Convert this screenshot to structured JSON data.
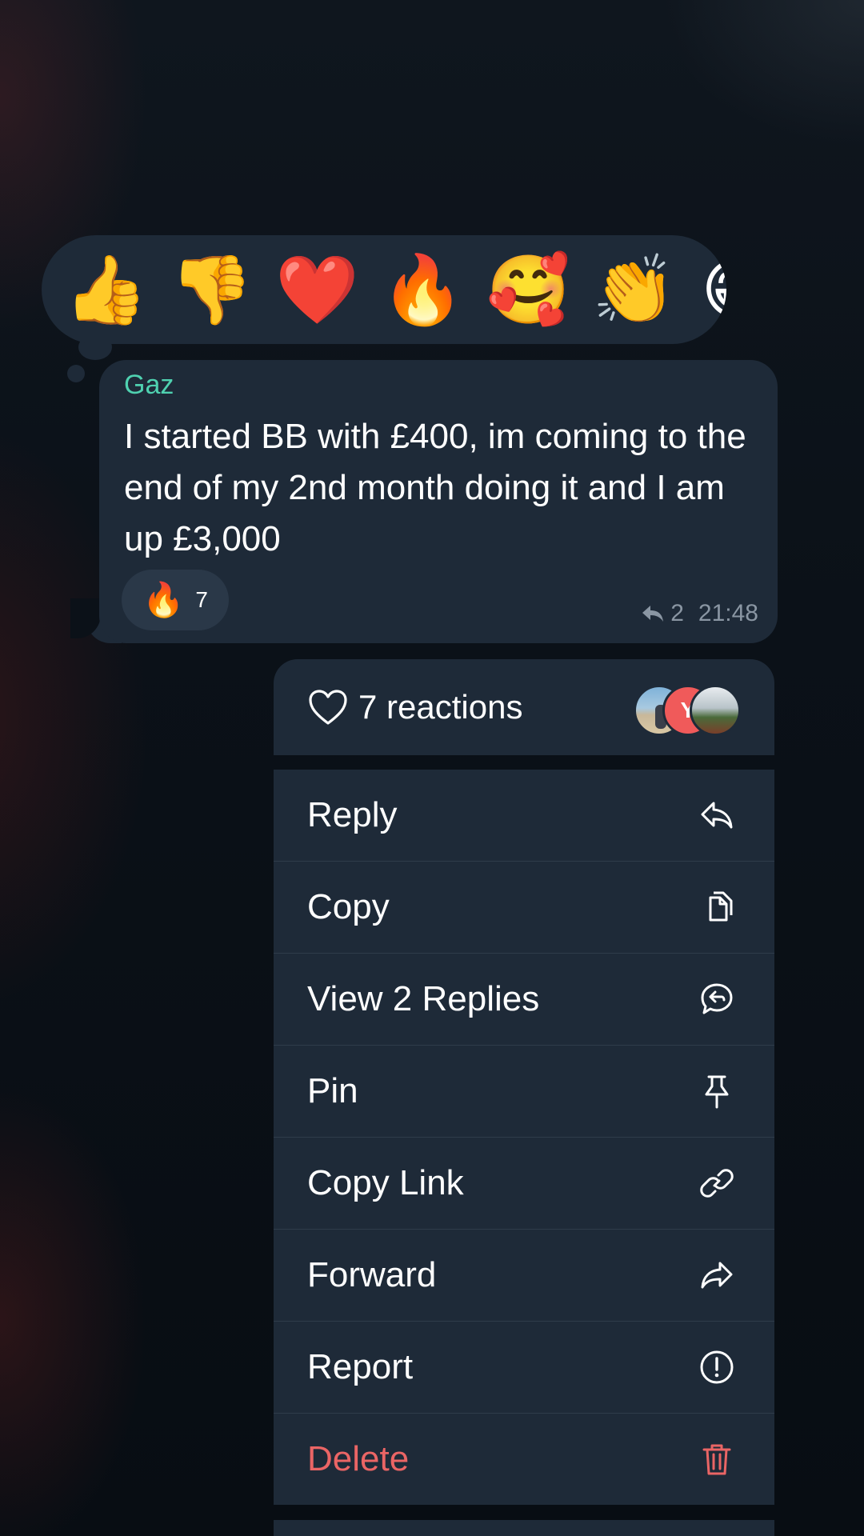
{
  "reaction_picker": {
    "emojis": [
      "👍",
      "👎",
      "❤️",
      "🔥",
      "🥰",
      "👏",
      "😁"
    ]
  },
  "message": {
    "sender": "Gaz",
    "text": "I started BB with £400, im coming to the end of my 2nd month doing it and I am up £3,000",
    "reaction": {
      "emoji": "🔥",
      "count": "7"
    },
    "reply_count": "2",
    "time": "21:48"
  },
  "menu": {
    "reactions_label": "7 reactions",
    "avatar_initial": "Y",
    "items": [
      {
        "label": "Reply",
        "icon": "reply-icon"
      },
      {
        "label": "Copy",
        "icon": "copy-icon"
      },
      {
        "label": "View 2 Replies",
        "icon": "view-replies-icon"
      },
      {
        "label": "Pin",
        "icon": "pin-icon"
      },
      {
        "label": "Copy Link",
        "icon": "link-icon"
      },
      {
        "label": "Forward",
        "icon": "forward-icon"
      },
      {
        "label": "Report",
        "icon": "report-icon"
      },
      {
        "label": "Delete",
        "icon": "trash-icon"
      }
    ]
  },
  "colors": {
    "background": "#0b1118",
    "bubble": "#1e2a38",
    "sender_name": "#4fd1b0",
    "meta_text": "#8a96a3",
    "delete": "#ea6565",
    "avatar_red": "#f05a5a"
  }
}
